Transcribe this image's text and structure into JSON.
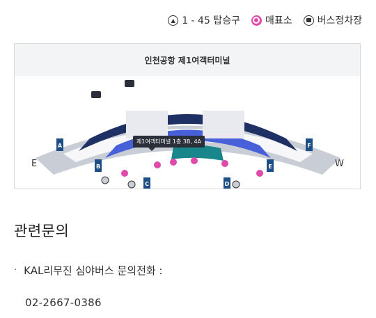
{
  "legend": {
    "gate_label": "1 - 45 탑승구",
    "ticket_label": "매표소",
    "bus_label": "버스정차장"
  },
  "map": {
    "title": "인천공항 제1여객터미널",
    "callout": "제1여객터미널 1층 3B, 4A",
    "door_letters": [
      "A",
      "B",
      "C",
      "D",
      "E",
      "F"
    ],
    "compass_east": "E",
    "compass_west": "W",
    "colors": {
      "zone_blue": "#4860d8",
      "zone_navy": "#1f3064",
      "zone_teal": "#18868a",
      "zone_gray": "#c9ced6",
      "marker_pink": "#e04aa8",
      "door_blue": "#1d4f86"
    }
  },
  "section": {
    "title": "관련문의",
    "bullet": "·",
    "item_label": "KAL리무진 심야버스 문의전화 :",
    "phone": "02-2667-0386"
  }
}
